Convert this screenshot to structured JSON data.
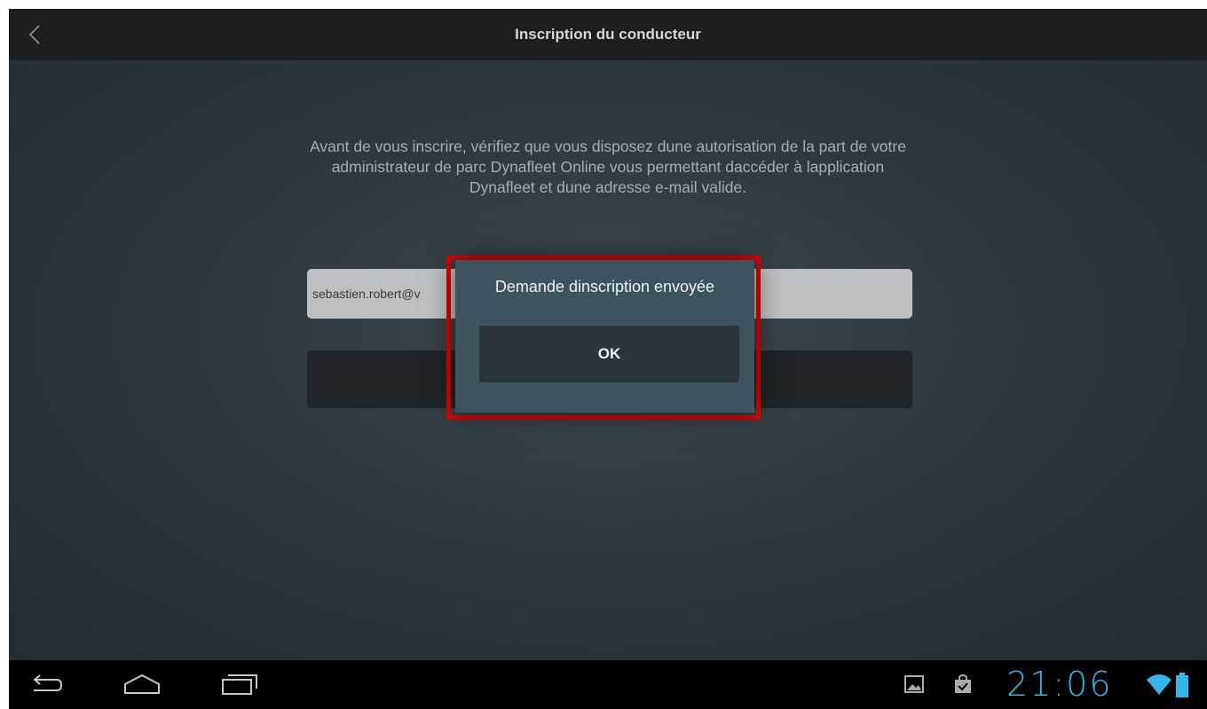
{
  "action_bar": {
    "title": "Inscription du conducteur"
  },
  "main": {
    "info_text": "Avant de vous inscrire, vérifiez que vous disposez dune autorisation de la part de votre administrateur de parc Dynafleet Online vous permettant daccéder à lapplication Dynafleet et dune adresse e-mail valide.",
    "email_value": "sebastien.robert@v",
    "submit_label": ""
  },
  "dialog": {
    "message": "Demande dinscription envoyée",
    "ok_label": "OK"
  },
  "status_bar": {
    "clock": "21:06",
    "icons": [
      "gallery-notification-icon",
      "shopping-bag-check-icon",
      "wifi-icon",
      "battery-icon"
    ]
  },
  "nav_bar": {
    "icons": [
      "back-icon",
      "home-icon",
      "recent-apps-icon"
    ]
  },
  "colors": {
    "accent": "#33b5e5",
    "highlight_frame": "#e00000",
    "dialog_bg": "#3e545d"
  }
}
